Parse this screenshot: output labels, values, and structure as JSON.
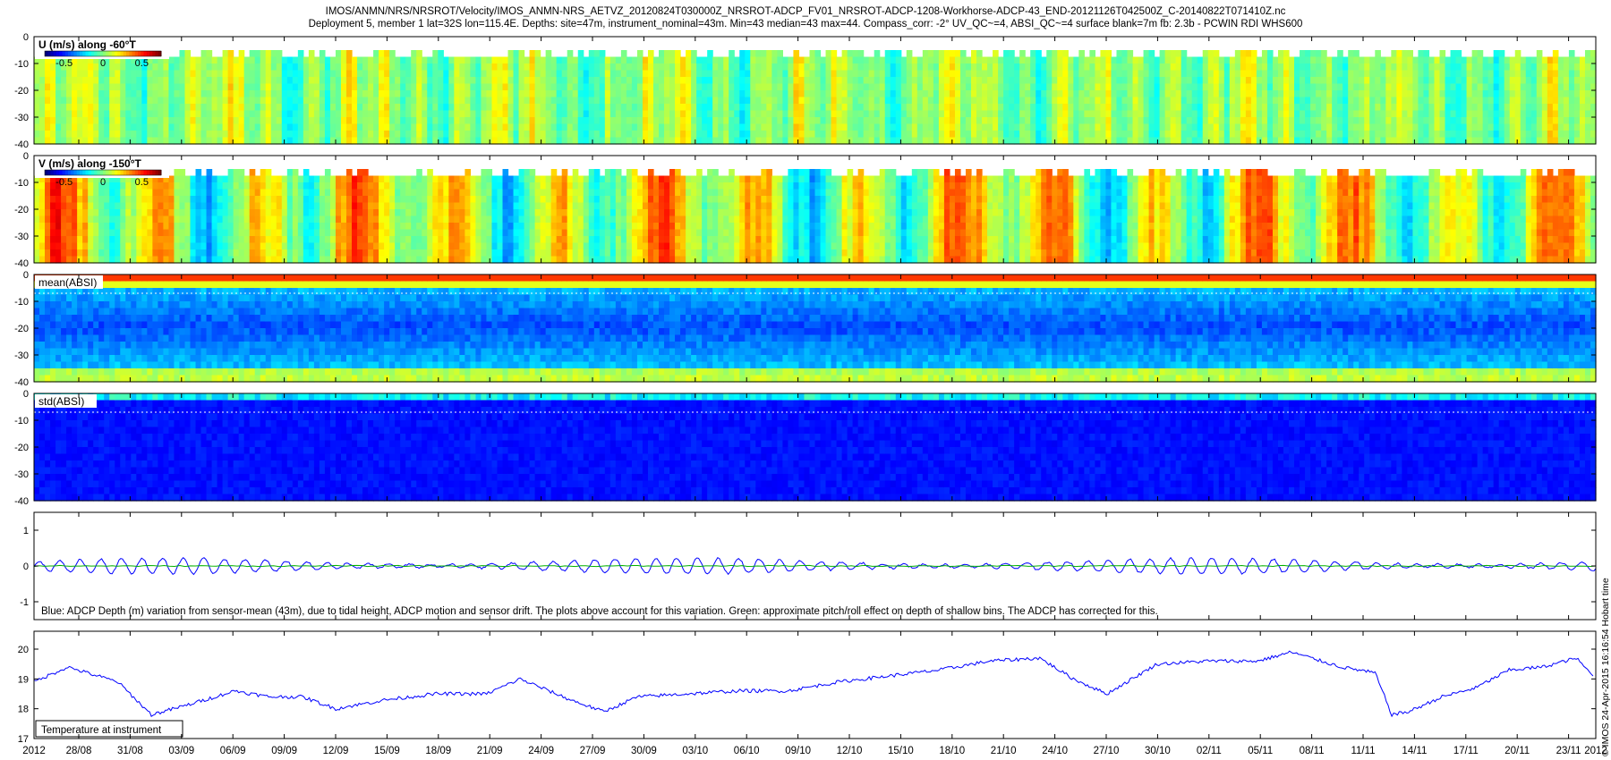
{
  "header": {
    "line1": "IMOS/ANMN/NRS/NRSROT/Velocity/IMOS_ANMN-NRS_AETVZ_20120824T030000Z_NRSROT-ADCP_FV01_NRSROT-ADCP-1208-Workhorse-ADCP-43_END-20121126T042500Z_C-20140822T071410Z.nc",
    "line2": "Deployment 5, member 1 lat=32S lon=115.4E. Depths: site=47m, instrument_nominal=43m. Min=43 median=43 max=44. Compass_corr: -2° UV_QC~=4, ABSI_QC~=4 surface blank=7m fb: 2.3b - PCWIN RDI WHS600"
  },
  "side_note": "© IMOS 24-Apr-2015 16:16:54 Hobart time",
  "colors": {
    "series_blue": "#0000ff",
    "series_green": "#00b000",
    "jet": [
      "#00007f",
      "#0000ff",
      "#0080ff",
      "#00ffff",
      "#80ff80",
      "#ffff00",
      "#ff8000",
      "#ff0000",
      "#7f0000"
    ]
  },
  "chart_data": [
    {
      "type": "heatmap",
      "label": "U (m/s) along -60°T",
      "yticks": [
        "0",
        "-10",
        "-20",
        "-30",
        "-40"
      ],
      "ylim": [
        -40,
        0
      ],
      "colorbar": {
        "range": [
          -0.75,
          0.75
        ],
        "ticks": [
          "-0.5",
          "0",
          "0.5"
        ]
      },
      "mean": 0.02,
      "amplitude": 0.35,
      "blank_depth": 7
    },
    {
      "type": "heatmap",
      "label": "V (m/s) along -150°T",
      "yticks": [
        "0",
        "-10",
        "-20",
        "-30",
        "-40"
      ],
      "ylim": [
        -40,
        0
      ],
      "colorbar": {
        "range": [
          -0.75,
          0.75
        ],
        "ticks": [
          "-0.5",
          "0",
          "0.5"
        ]
      },
      "mean": 0.1,
      "amplitude": 0.6,
      "blank_depth": 7
    },
    {
      "type": "heatmap",
      "label": "mean(ABSI)",
      "yticks": [
        "0",
        "-10",
        "-20",
        "-30",
        "-40"
      ],
      "ylim": [
        -40,
        0
      ],
      "blank_depth": 7
    },
    {
      "type": "heatmap",
      "label": "std(ABSI)",
      "yticks": [
        "0",
        "-10",
        "-20",
        "-30",
        "-40"
      ],
      "ylim": [
        -40,
        0
      ],
      "blank_depth": 7
    },
    {
      "type": "line",
      "annotation": "Blue: ADCP Depth (m) variation from sensor-mean (43m), due to tidal height, ADCP motion and sensor drift. The plots above account for this variation. Green: approximate pitch/roll effect on depth of shallow bins. The ADCP has corrected for this.",
      "yticks": [
        "1",
        "0",
        "-1"
      ],
      "ylim": [
        -1.5,
        1.5
      ],
      "series": [
        {
          "color": "#0000ff",
          "mean": 0.0,
          "tidal_amplitude": 0.22
        },
        {
          "color": "#00b000",
          "mean": 0.0
        }
      ]
    },
    {
      "type": "line",
      "annotation": "Temperature at instrument",
      "yticks": [
        "20",
        "19",
        "18",
        "17"
      ],
      "ylim": [
        17,
        20.6
      ],
      "x": [
        "2012-08-25",
        "2012-08-27",
        "2012-08-30",
        "2012-09-01",
        "2012-09-03",
        "2012-09-06",
        "2012-09-08",
        "2012-09-10",
        "2012-09-12",
        "2012-09-15",
        "2012-09-18",
        "2012-09-21",
        "2012-09-23",
        "2012-09-26",
        "2012-09-28",
        "2012-09-30",
        "2012-10-03",
        "2012-10-06",
        "2012-10-09",
        "2012-10-12",
        "2012-10-15",
        "2012-10-18",
        "2012-10-21",
        "2012-10-24",
        "2012-10-26",
        "2012-10-28",
        "2012-10-31",
        "2012-11-03",
        "2012-11-06",
        "2012-11-08",
        "2012-11-11",
        "2012-11-13",
        "2012-11-14",
        "2012-11-15",
        "2012-11-17",
        "2012-11-19",
        "2012-11-21",
        "2012-11-23",
        "2012-11-25",
        "2012-11-26"
      ],
      "y": [
        18.9,
        19.4,
        18.9,
        17.8,
        18.1,
        18.6,
        18.4,
        18.4,
        18.0,
        18.3,
        18.5,
        18.5,
        19.0,
        18.3,
        17.9,
        18.4,
        18.5,
        18.6,
        18.6,
        18.9,
        19.1,
        19.3,
        19.6,
        19.7,
        19.0,
        18.5,
        19.5,
        19.6,
        19.6,
        19.9,
        19.4,
        19.2,
        17.8,
        17.9,
        18.4,
        18.7,
        19.3,
        19.4,
        19.7,
        19.1
      ]
    }
  ],
  "time_axis": {
    "labels": [
      "2012",
      "28/08",
      "31/08",
      "03/09",
      "06/09",
      "09/09",
      "12/09",
      "15/09",
      "18/09",
      "21/09",
      "24/09",
      "27/09",
      "30/09",
      "03/10",
      "06/10",
      "09/10",
      "12/10",
      "15/10",
      "18/10",
      "21/10",
      "24/10",
      "27/10",
      "30/10",
      "02/11",
      "05/11",
      "08/11",
      "11/11",
      "14/11",
      "17/11",
      "20/11",
      "23/11",
      "2012"
    ]
  }
}
